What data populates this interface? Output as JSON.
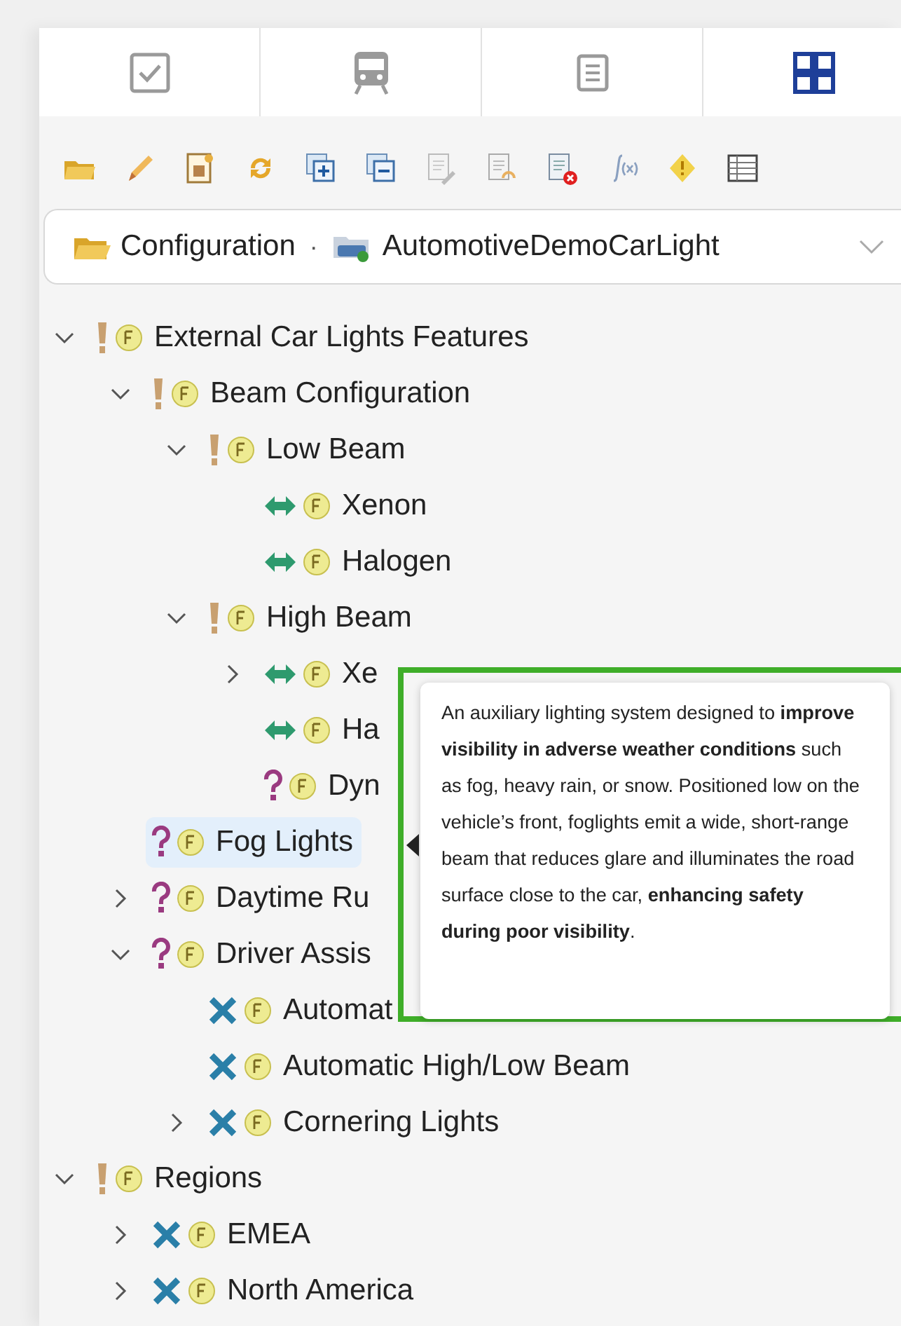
{
  "tabs": [
    {
      "selected": false
    },
    {
      "selected": false
    },
    {
      "selected": false
    },
    {
      "selected": true
    }
  ],
  "breadcrumb": {
    "items": [
      "Configuration",
      "AutomotiveDemoCarLight"
    ],
    "separator": "·"
  },
  "tree": [
    {
      "label": "External Car Lights Features",
      "kind": "mandatory",
      "expanded": true,
      "selected": false,
      "children": [
        {
          "label": "Beam Configuration",
          "kind": "mandatory",
          "expanded": true,
          "selected": false,
          "children": [
            {
              "label": "Low Beam",
              "kind": "mandatory",
              "expanded": true,
              "selected": false,
              "children": [
                {
                  "label": "Xenon",
                  "kind": "alternative",
                  "selected": false
                },
                {
                  "label": "Halogen",
                  "kind": "alternative",
                  "selected": false
                }
              ]
            },
            {
              "label": "High Beam",
              "kind": "mandatory",
              "expanded": true,
              "selected": false,
              "children": [
                {
                  "label": "Xe",
                  "kind": "alternative",
                  "expanded": false,
                  "selected": false
                },
                {
                  "label": "Ha",
                  "kind": "alternative",
                  "selected": false
                },
                {
                  "label": "Dyn",
                  "kind": "optional",
                  "selected": false
                }
              ]
            }
          ]
        },
        {
          "label": "Fog Lights",
          "kind": "optional",
          "selected": true
        },
        {
          "label": "Daytime Ru",
          "kind": "optional",
          "expanded": false,
          "selected": false
        },
        {
          "label": "Driver Assis",
          "kind": "optional",
          "expanded": true,
          "selected": false,
          "children": [
            {
              "label": "Automat",
              "kind": "or",
              "selected": false
            },
            {
              "label": "Automatic High/Low Beam",
              "kind": "or",
              "selected": false
            },
            {
              "label": "Cornering Lights",
              "kind": "or",
              "expanded": false,
              "selected": false
            }
          ]
        }
      ]
    },
    {
      "label": "Regions",
      "kind": "mandatory",
      "expanded": true,
      "selected": false,
      "children": [
        {
          "label": "EMEA",
          "kind": "or",
          "expanded": false,
          "selected": false
        },
        {
          "label": "North America",
          "kind": "or",
          "expanded": false,
          "selected": false
        }
      ]
    }
  ],
  "tooltip": {
    "text": "An auxiliary lighting system designed to **improve visibility in adverse weather conditions** such as fog, heavy rain, or snow. Positioned low on the vehicle’s front, foglights emit a wide, short-range beam that reduces glare and illuminates the road surface close to the car, **enhancing safety during poor visibility**."
  }
}
